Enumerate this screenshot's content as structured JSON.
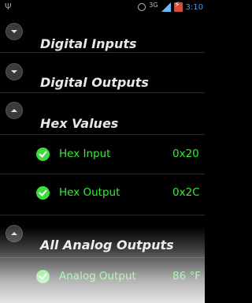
{
  "status": {
    "network_label": "3G",
    "time": "3:10"
  },
  "sections": {
    "digital_inputs": "Digital Inputs",
    "digital_outputs": "Digital Outputs",
    "hex_values": "Hex Values",
    "all_analog_outputs": "All Analog Outputs"
  },
  "hex_items": [
    {
      "label": "Hex Input",
      "value": "0x20"
    },
    {
      "label": "Hex Output",
      "value": "0x2C"
    }
  ],
  "analog_items": [
    {
      "label": "Analog Output",
      "value": "86 °F"
    }
  ],
  "colors": {
    "accent": "#33ee33",
    "status_blue": "#3ea0ff"
  },
  "icons": {
    "usb": "usb-icon",
    "alarm": "alarm-icon",
    "signal": "signal-icon",
    "battery": "battery-icon",
    "expand": "chevron-down-icon",
    "collapse": "chevron-up-icon",
    "check": "check-icon"
  }
}
